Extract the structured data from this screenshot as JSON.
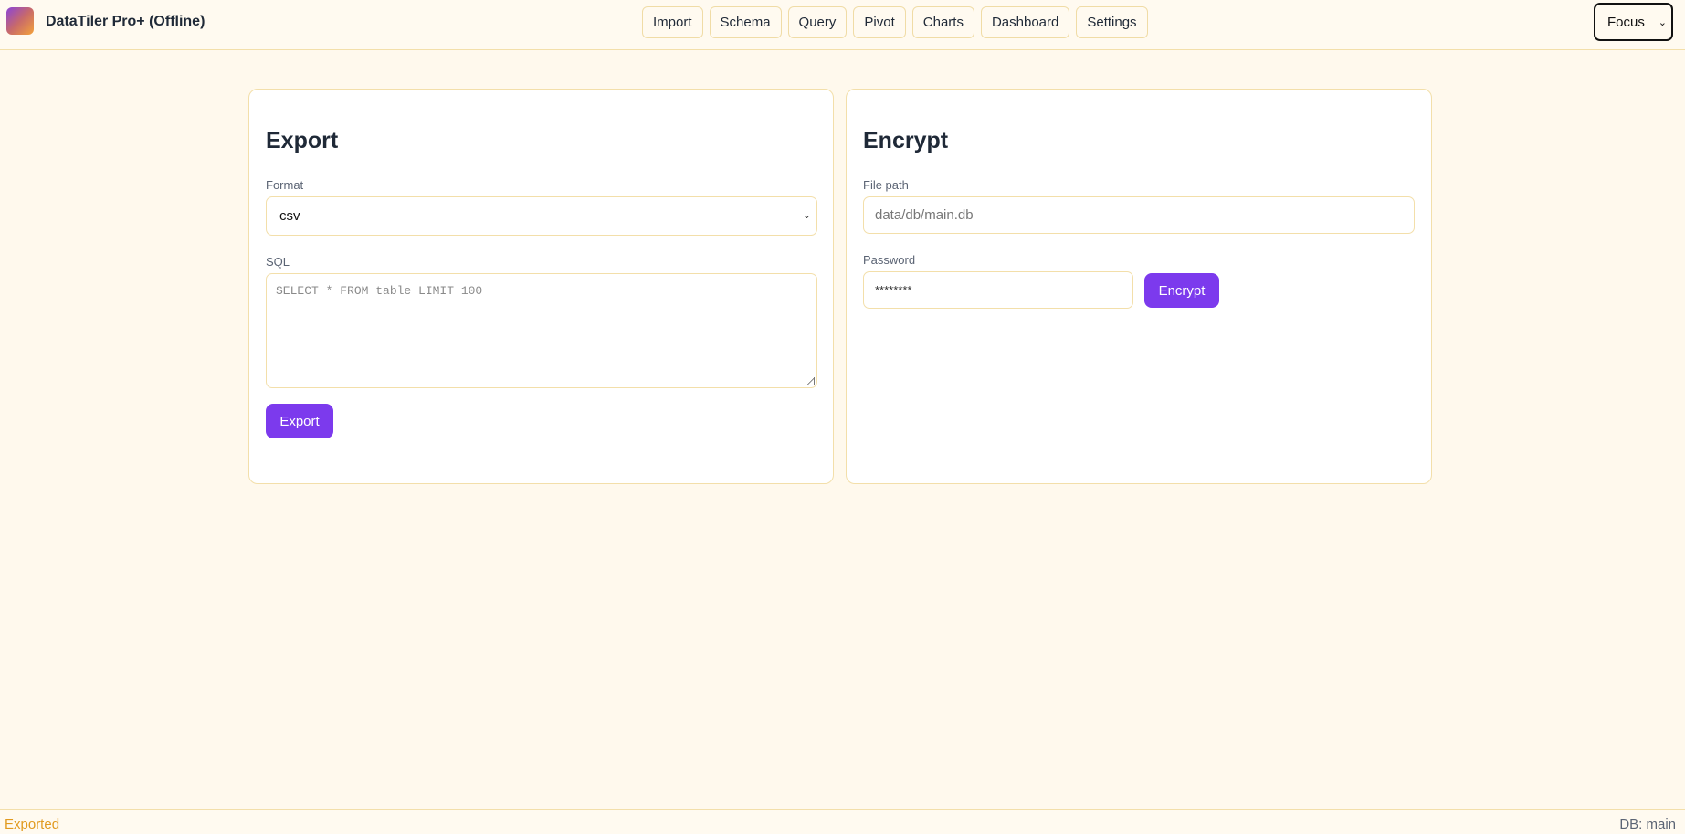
{
  "app": {
    "title": "DataTiler Pro+ (Offline)"
  },
  "nav": {
    "items": [
      "Import",
      "Schema",
      "Query",
      "Pivot",
      "Charts",
      "Dashboard",
      "Settings"
    ]
  },
  "mode_select": {
    "value": "Focus"
  },
  "export_panel": {
    "title": "Export",
    "format_label": "Format",
    "format_value": "csv",
    "sql_label": "SQL",
    "sql_placeholder": "SELECT * FROM table LIMIT 100",
    "button": "Export"
  },
  "encrypt_panel": {
    "title": "Encrypt",
    "path_label": "File path",
    "path_placeholder": "data/db/main.db",
    "password_label": "Password",
    "password_value": "********",
    "button": "Encrypt"
  },
  "status": {
    "message": "Exported",
    "db": "DB: main"
  },
  "colors": {
    "accent": "#7c3aed",
    "status": "#e19a1f",
    "border": "#f3dfaa",
    "background": "#fff9ed"
  },
  "icons": {
    "logo": "app-logo",
    "dropdown": "chevron-down-icon"
  }
}
